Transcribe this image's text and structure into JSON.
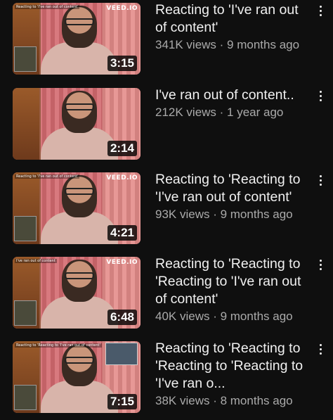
{
  "videos": [
    {
      "title": "Reacting to 'I've ran out of content'",
      "views": "341K views",
      "age": "9 months ago",
      "duration": "3:15",
      "watermark": "VEED.IO",
      "caption": "Reacting to 'I've ran out of content'",
      "has_inset": true,
      "has_right_inset": false
    },
    {
      "title": "I've ran out of content..",
      "views": "212K views",
      "age": "1 year ago",
      "duration": "2:14",
      "watermark": "",
      "caption": "",
      "has_inset": false,
      "has_right_inset": false
    },
    {
      "title": "Reacting to 'Reacting to 'I've ran out of content'",
      "views": "93K views",
      "age": "9 months ago",
      "duration": "4:21",
      "watermark": "VEED.IO",
      "caption": "Reacting to 'I've ran out of content'",
      "has_inset": true,
      "has_right_inset": false
    },
    {
      "title": "Reacting to 'Reacting to 'Reacting to 'I've ran out of content'",
      "views": "40K views",
      "age": "9 months ago",
      "duration": "6:48",
      "watermark": "VEED.IO",
      "caption": "I've ran out of content",
      "has_inset": true,
      "has_right_inset": false
    },
    {
      "title": "Reacting to 'Reacting to 'Reacting to 'Reacting to 'I've ran o...",
      "views": "38K views",
      "age": "8 months ago",
      "duration": "7:15",
      "watermark": "",
      "caption": "Reacting to 'Reacting to 'I've ran out of content'",
      "has_inset": true,
      "has_right_inset": true
    }
  ],
  "meta_separator": " · ",
  "more_icon": "more-vertical-icon"
}
